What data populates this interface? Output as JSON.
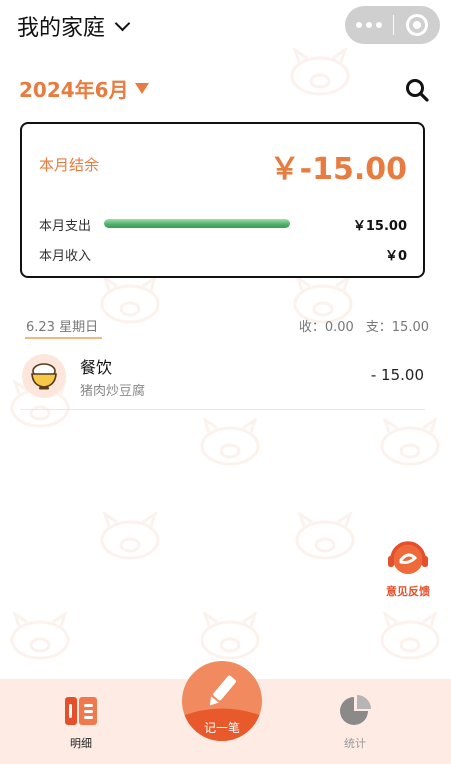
{
  "header": {
    "title": "我的家庭"
  },
  "month": {
    "label": "2024年6月"
  },
  "summary": {
    "balance_label": "本月结余",
    "balance_value": "￥-15.00",
    "expense_label": "本月支出",
    "expense_value": "￥15.00",
    "expense_bar_fraction": 1.0,
    "income_label": "本月收入",
    "income_value": "￥0"
  },
  "day": {
    "label": "6.23 星期日",
    "income": "收：0.00",
    "expense": "支：15.00"
  },
  "records": [
    {
      "category": "餐饮",
      "note": "猪肉炒豆腐",
      "amount": "- 15.00",
      "icon": "rice-bowl-icon"
    }
  ],
  "feedback": {
    "label": "意见反馈"
  },
  "tabbar": {
    "detail_label": "明细",
    "add_label": "记一笔",
    "stats_label": "统计"
  },
  "colors": {
    "accent": "#e87b3f",
    "bar_green": "#4caf6a",
    "tabbar_bg": "#fdebe4",
    "fab": "#f18a5e"
  }
}
